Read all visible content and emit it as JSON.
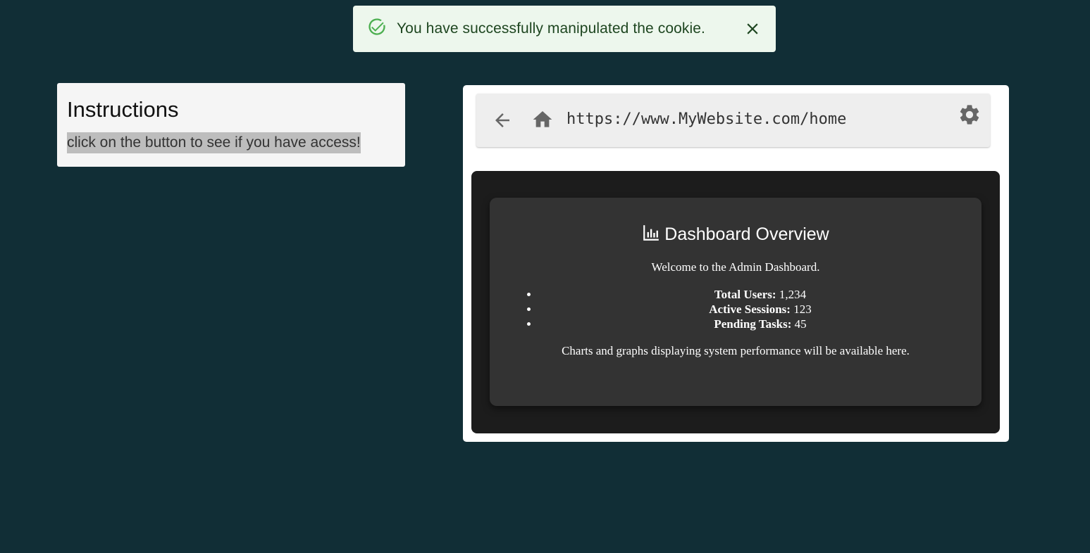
{
  "toast": {
    "icon": "check-circle-icon",
    "message": "You have successfully manipulated the cookie.",
    "close_icon": "close-icon",
    "colors": {
      "background": "#edf7ed",
      "text": "#1e4620",
      "icon": "#4caf50"
    }
  },
  "instructions": {
    "title": "Instructions",
    "text": "click on the button to see if you have access!"
  },
  "browser": {
    "back_icon": "arrow-left-icon",
    "home_icon": "home-icon",
    "url": "https://www.MyWebsite.com/home",
    "settings_icon": "gear-icon"
  },
  "dashboard": {
    "icon": "bar-chart-icon",
    "title": "Dashboard Overview",
    "welcome": "Welcome to the Admin Dashboard.",
    "stats": [
      {
        "label": "Total Users:",
        "value": "1,234"
      },
      {
        "label": "Active Sessions:",
        "value": "123"
      },
      {
        "label": "Pending Tasks:",
        "value": "45"
      }
    ],
    "note": "Charts and graphs displaying system performance will be available here."
  },
  "colors": {
    "page_background": "#112e36",
    "card_background": "#333333",
    "viewport_background": "#1c1c1c"
  }
}
